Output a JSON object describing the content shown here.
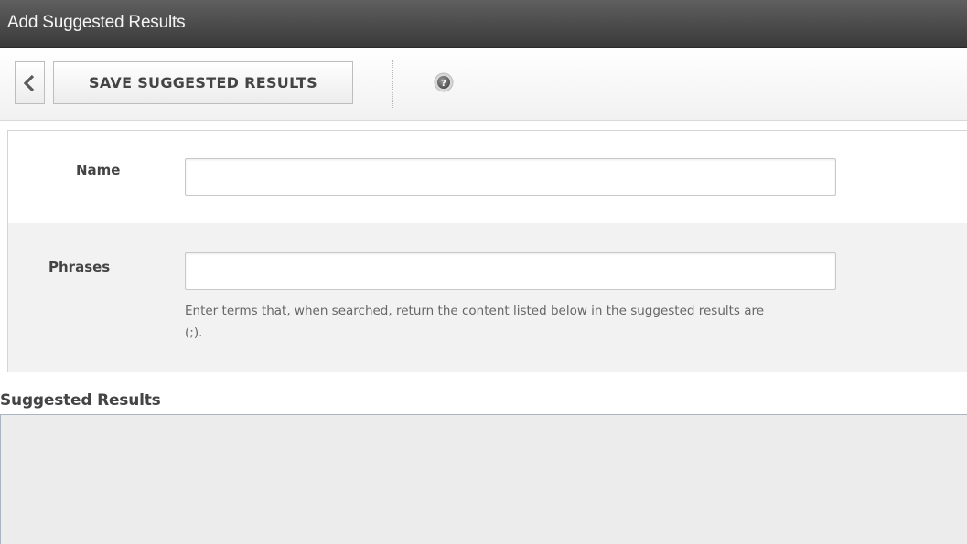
{
  "window": {
    "title": "Add Suggested Results"
  },
  "toolbar": {
    "back_icon": "chevron-left-icon",
    "save_label": "SAVE SUGGESTED RESULTS",
    "help_icon": "help-icon"
  },
  "form": {
    "name": {
      "label": "Name",
      "value": ""
    },
    "phrases": {
      "label": "Phrases",
      "value": "",
      "hint_line1": "Enter terms that, when searched, return the content listed below in the suggested results are",
      "hint_line2": "(;)."
    }
  },
  "suggested_results": {
    "title": "Suggested Results"
  }
}
